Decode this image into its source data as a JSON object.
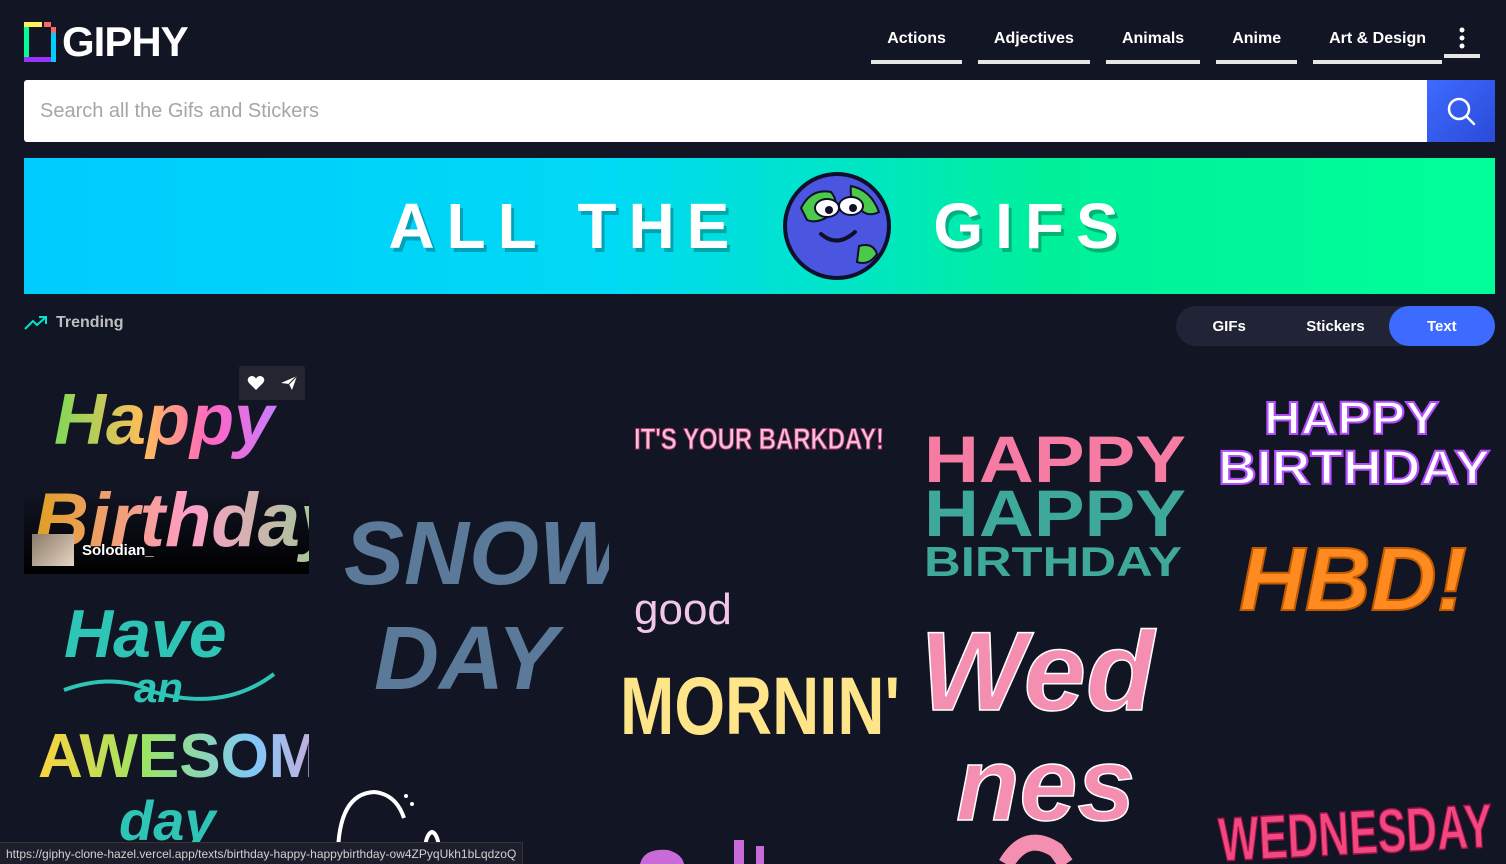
{
  "logo": {
    "text": "GIPHY"
  },
  "nav": {
    "items": [
      "Actions",
      "Adjectives",
      "Animals",
      "Anime",
      "Art & Design"
    ],
    "more_icon": "kebab-menu-icon"
  },
  "search": {
    "placeholder": "Search all the Gifs and Stickers",
    "icon": "search-icon"
  },
  "banner": {
    "left_text": "ALL THE",
    "right_text": "GIFS"
  },
  "trending": {
    "label": "Trending",
    "icon": "trending-up-icon"
  },
  "toggle": {
    "options": [
      "GIFs",
      "Stickers",
      "Text"
    ],
    "selected": "Text"
  },
  "gifs": [
    {
      "line1": "Happy",
      "line2": "Birthday",
      "user": "Solodian_"
    },
    {
      "line1": "SNOW",
      "line2": "DAY"
    },
    {
      "line1": "IT'S YOUR BARKDAY!"
    },
    {
      "line1": "good",
      "line2": "MORNIN'"
    },
    {
      "line1": "HAPPY",
      "line2": "HAPPY",
      "line3": "BIRTHDAY"
    },
    {
      "line1": "Wed",
      "line2": "nes"
    },
    {
      "line1": "HAPPY",
      "line2": "BIRTHDAY"
    },
    {
      "line1": "HBD!"
    },
    {
      "line1": "Have",
      "line2": "an",
      "line3": "AWESOME",
      "line4": "day"
    },
    {
      "line1": "WEDNESDAY"
    }
  ],
  "status_bar": {
    "url": "https://giphy-clone-hazel.vercel.app/texts/birthday-happy-happybirthday-ow4ZPyqUkh1bLqdzoQ"
  },
  "colors": {
    "background": "#121524",
    "accent": "#3d6bff",
    "banner_start": "#00ccff",
    "banner_end": "#00ff99"
  }
}
